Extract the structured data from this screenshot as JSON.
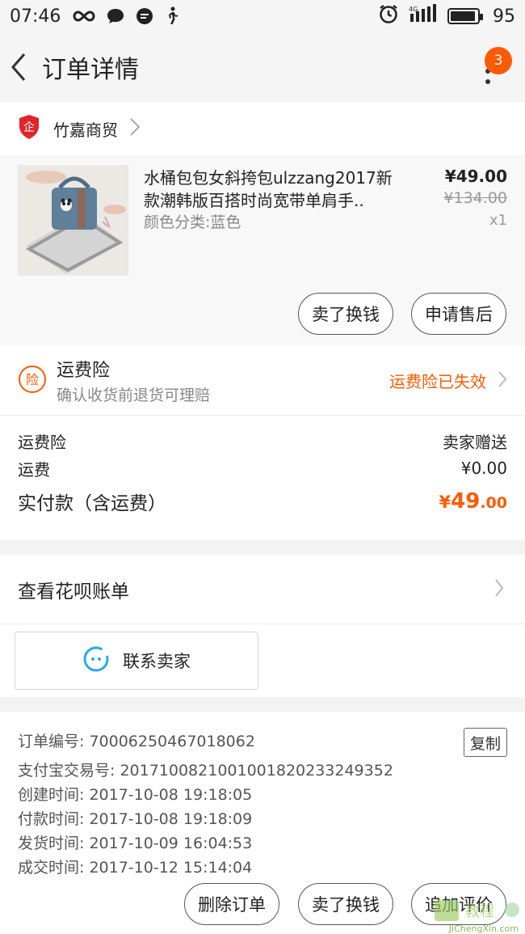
{
  "status_bar": {
    "time": "07:46",
    "battery": "95",
    "network": "4G"
  },
  "nav": {
    "title": "订单详情",
    "badge_count": "3"
  },
  "shop": {
    "name": "竹嘉商贸"
  },
  "product": {
    "title": "水桶包包女斜挎包ulzzang2017新款潮韩版百搭时尚宽带单肩手..",
    "sku": "颜色分类:蓝色",
    "price": "¥49.00",
    "original_price": "¥134.00",
    "quantity": "x1",
    "btn_sell": "卖了换钱",
    "btn_after_sale": "申请售后"
  },
  "insurance": {
    "icon_char": "险",
    "title": "运费险",
    "subtitle": "确认收货前退货可理赔",
    "status": "运费险已失效"
  },
  "fees": {
    "ins_label": "运费险",
    "ins_value": "卖家赠送",
    "ship_label": "运费",
    "ship_value": "¥0.00",
    "total_label": "实付款（含运费）",
    "total_symbol": "¥",
    "total_int": "49",
    "total_dec": ".00"
  },
  "huabei": {
    "label": "查看花呗账单"
  },
  "contact": {
    "label": "联系卖家"
  },
  "order_info": {
    "order_no": "订单编号: 70006250467018062",
    "copy": "复制",
    "alipay_no": "支付宝交易号: 2017100821001001820233249352",
    "created": "创建时间: 2017-10-08 19:18:05",
    "paid": "付款时间: 2017-10-08 19:18:09",
    "shipped": "发货时间: 2017-10-09 16:04:53",
    "completed": "成交时间: 2017-10-12 15:14:04"
  },
  "bottom_bar": {
    "delete": "删除订单",
    "sell": "卖了换钱",
    "review": "追加评价"
  },
  "watermark": {
    "text": "JiChengXin.com",
    "logo_text": "教程"
  },
  "colors": {
    "accent": "#ff5a00",
    "shop_icon": "#e0262b",
    "contact_icon": "#2ba7f0"
  }
}
